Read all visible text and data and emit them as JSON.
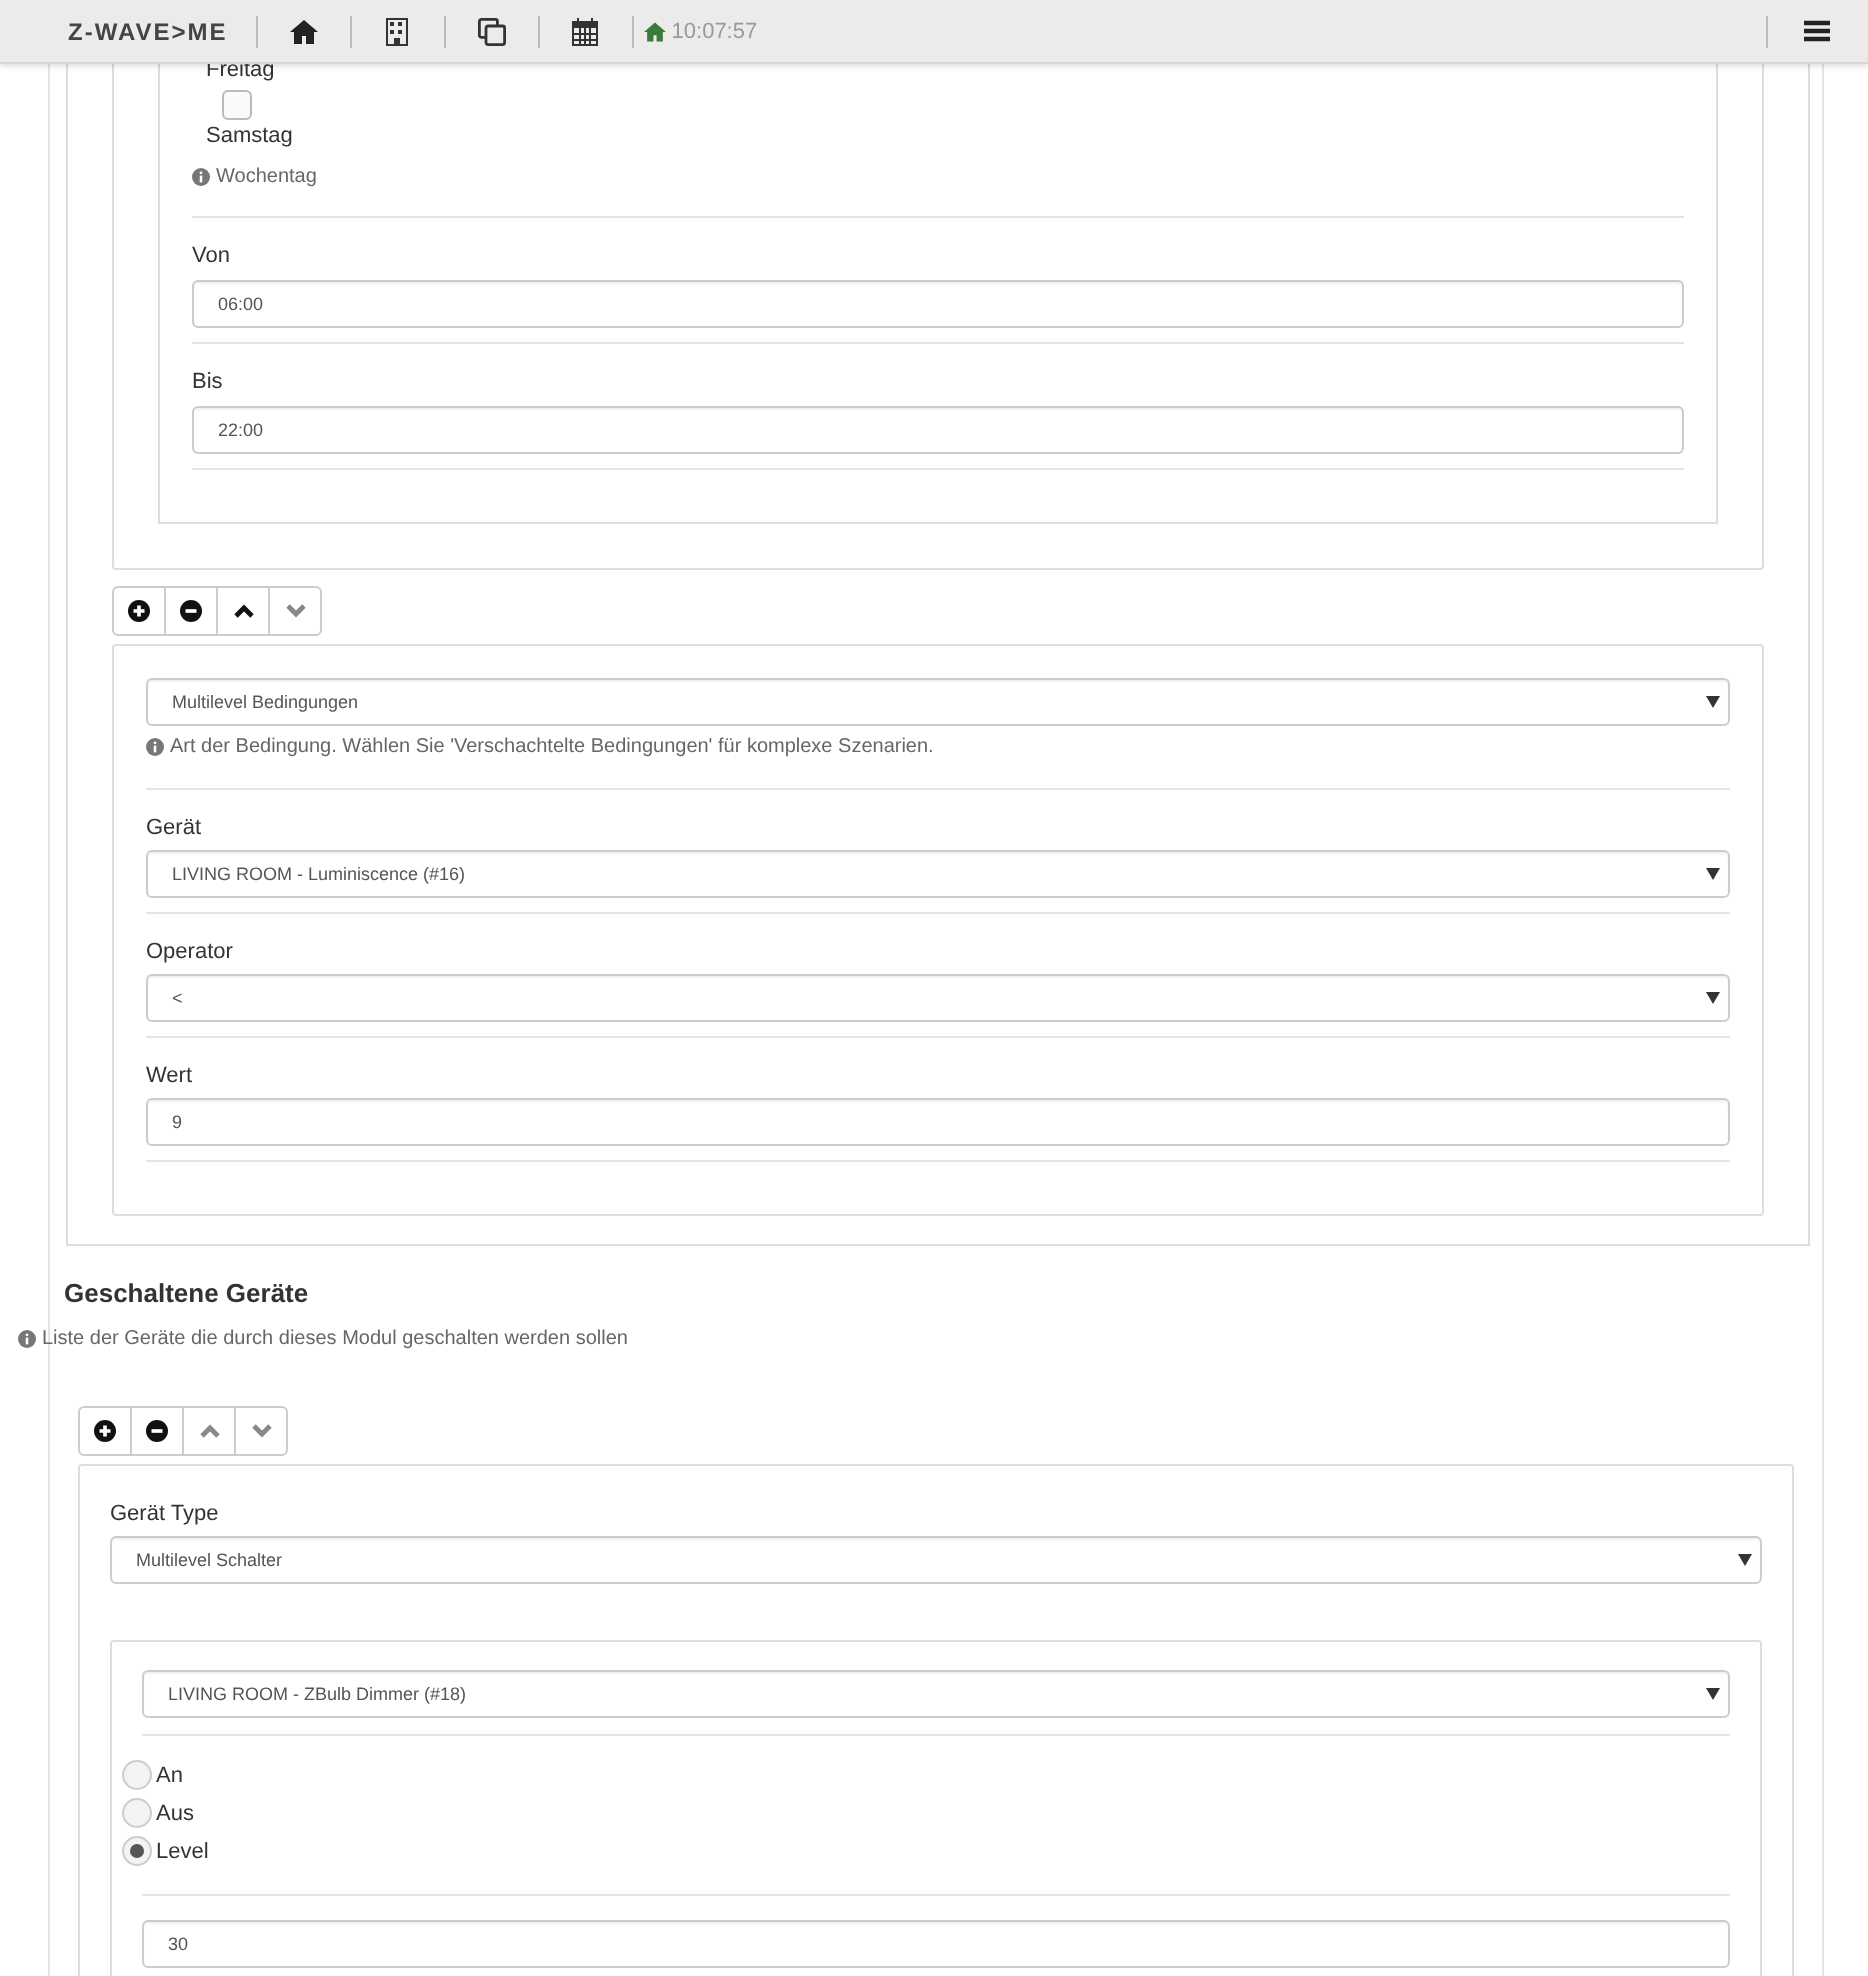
{
  "header": {
    "logo": "Z-WAVE>ME",
    "time": "10:07:57"
  },
  "weekday": {
    "cut_label": "Freitag",
    "days": [
      {
        "label": "Samstag",
        "checked": false
      }
    ],
    "help": "Wochentag"
  },
  "time_fields": [
    {
      "label": "Von",
      "value": "06:00"
    },
    {
      "label": "Bis",
      "value": "22:00"
    }
  ],
  "condition": {
    "toolbar": [
      {
        "kind": "add",
        "disabled": false
      },
      {
        "kind": "remove",
        "disabled": false
      },
      {
        "kind": "up",
        "disabled": false
      },
      {
        "kind": "down",
        "disabled": true
      }
    ],
    "type_select": "Multilevel Bedingungen",
    "help": "Art der Bedingung. Wählen Sie 'Verschachtelte Bedingungen' für komplexe Szenarien.",
    "fields": [
      {
        "label": "Gerät",
        "kind": "select",
        "value": "LIVING ROOM - Luminiscence (#16)"
      },
      {
        "label": "Operator",
        "kind": "select",
        "value": "<"
      },
      {
        "label": "Wert",
        "kind": "input",
        "value": "9"
      }
    ]
  },
  "switched_devices": {
    "title": "Geschaltene Geräte",
    "help": "Liste der Geräte die durch dieses Modul geschalten werden sollen",
    "toolbar": [
      {
        "kind": "add",
        "disabled": false
      },
      {
        "kind": "remove",
        "disabled": false
      },
      {
        "kind": "up",
        "disabled": true
      },
      {
        "kind": "down",
        "disabled": true
      }
    ],
    "device_type_label": "Gerät Type",
    "device_type": "Multilevel Schalter",
    "device": "LIVING ROOM - ZBulb Dimmer (#18)",
    "options": [
      {
        "label": "An",
        "selected": false
      },
      {
        "label": "Aus",
        "selected": false
      },
      {
        "label": "Level",
        "selected": true
      }
    ],
    "level_value": "30"
  }
}
